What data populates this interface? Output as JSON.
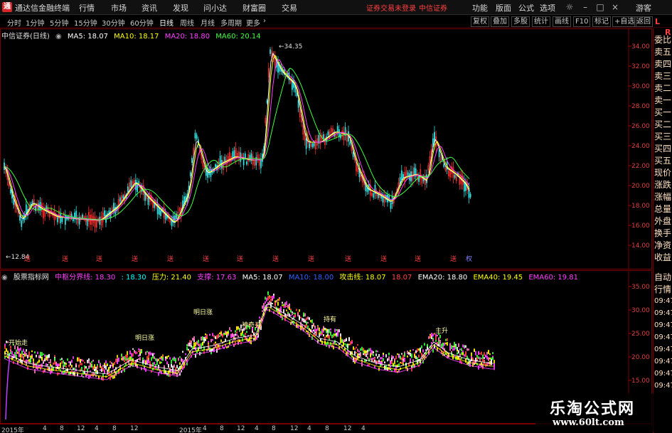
{
  "titlebar": {
    "app_title": "通达信金融终端",
    "menus": [
      "行情",
      "市场",
      "资讯",
      "发现",
      "问小达",
      "财富圈",
      "交易"
    ],
    "warning": "证券交易未登录",
    "broker": "中信证券",
    "right_menus": [
      "功能",
      "版面",
      "公式",
      "选项"
    ],
    "user": "游客"
  },
  "toolbar": {
    "periods": [
      "分时",
      "1分钟",
      "5分钟",
      "15分钟",
      "30分钟",
      "60分钟",
      "日线",
      "周线",
      "月线",
      "多周期",
      "更多"
    ],
    "active_period": "日线",
    "tools": [
      "复权",
      "叠加",
      "多股",
      "统计",
      "画线",
      "F10",
      "标记",
      "+自选",
      "返回"
    ]
  },
  "main_chart": {
    "stock_title": "中信证券(日线)",
    "ma": [
      {
        "label": "MA5: 18.07",
        "color": "#ffffff"
      },
      {
        "label": "MA10: 18.17",
        "color": "#ffff00"
      },
      {
        "label": "MA20: 18.80",
        "color": "#ff40ff"
      },
      {
        "label": "MA60: 20.14",
        "color": "#40ff40"
      }
    ],
    "y_ticks": [
      "34.00",
      "32.00",
      "30.00",
      "28.00",
      "26.00",
      "24.00",
      "22.00",
      "20.00",
      "18.00",
      "16.00",
      "14.00"
    ],
    "high_label": "34.35",
    "low_label": "12.84",
    "event_labels": [
      "送",
      "权"
    ]
  },
  "indicator_chart": {
    "name": "股票指标网",
    "fields": [
      {
        "label": "中枢分界线: 18.30",
        "color": "#ff40ff"
      },
      {
        "label": ": 18.30",
        "color": "#00ffff"
      },
      {
        "label": "压力: 21.40",
        "color": "#ffff00"
      },
      {
        "label": "支撑: 17.63",
        "color": "#ff40ff"
      },
      {
        "label": "MA5: 18.07",
        "color": "#ffffff"
      },
      {
        "label": "MA10: 18.00",
        "color": "#3060ff"
      },
      {
        "label": "攻击线: 18.07",
        "color": "#ffff00"
      },
      {
        "label": "18.07",
        "color": "#ff4040"
      },
      {
        "label": "EMA20: 18.80",
        "color": "#ffffff"
      },
      {
        "label": "EMA40: 19.45",
        "color": "#ffff00"
      },
      {
        "label": "EMA60: 19.81",
        "color": "#ff40ff"
      }
    ],
    "y_ticks": [
      "35.00",
      "30.00",
      "25.00",
      "20.00",
      "15.00"
    ],
    "signal_texts": [
      "明日涨",
      "神奇买",
      "开始走",
      "明日涨",
      "主升",
      "持有"
    ]
  },
  "side_panel": {
    "header": "L",
    "header2": "R",
    "items": [
      "委比",
      "卖五",
      "卖四",
      "卖三",
      "卖二",
      "卖一",
      "买一",
      "买二",
      "买三",
      "买四",
      "买五",
      "现价",
      "涨跌",
      "涨幅",
      "总量",
      "外盘",
      "换手",
      "净资",
      "收益"
    ],
    "lower_items": [
      "自动",
      "行情"
    ],
    "times": [
      "09:47",
      "09:47",
      "09:47",
      "09:47",
      "09:47",
      "09:47",
      "09:47",
      "09:47"
    ]
  },
  "time_axis": {
    "ticks": [
      "2015年",
      "4",
      "8",
      "12",
      "4",
      "8",
      "12",
      "2015年",
      "4",
      "8",
      "12",
      "4",
      "8",
      "12",
      "4",
      "8",
      "12",
      "4"
    ]
  },
  "watermark": {
    "cn": "乐淘公式网",
    "url": "www.60lt.com"
  }
}
